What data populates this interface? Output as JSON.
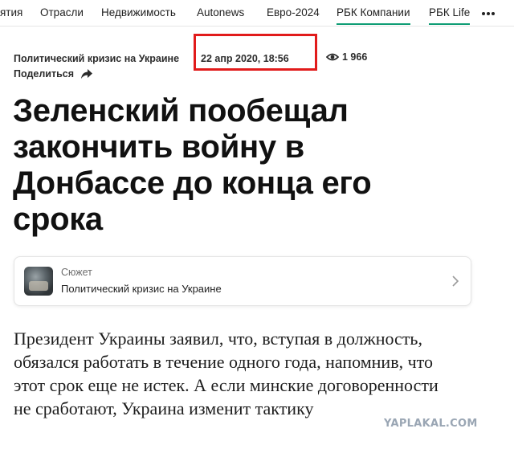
{
  "nav": {
    "items": [
      {
        "label": "ятия"
      },
      {
        "label": "Отрасли"
      },
      {
        "label": "Недвижимость"
      },
      {
        "label": "Autonews"
      },
      {
        "label": "Евро-2024"
      },
      {
        "label": "РБК Компании"
      },
      {
        "label": "РБК Life"
      }
    ],
    "more_icon": "more-dots-icon"
  },
  "article": {
    "rubric": "Политический кризис на Украине",
    "date": "22 апр 2020, 18:56",
    "views": "1 966",
    "views_icon": "eye-icon",
    "share_label": "Поделиться",
    "share_icon": "share-arrow-icon",
    "headline": "Зеленский пообещал закончить войну в Донбассе до конца его срока",
    "story": {
      "kicker": "Сюжет",
      "title": "Политический кризис на Украине",
      "chevron_icon": "chevron-right-icon"
    },
    "lead": "Президент Украины заявил, что, вступая в должность, обязался работать в течение одного года, напомнив, что этот срок еще не истек. А если минские договоренности не сработают, Украина изменит тактику"
  },
  "highlight_color": "#e11b1b",
  "accent_color": "#0f9d75",
  "watermark": "YAPLAKAL.COM"
}
